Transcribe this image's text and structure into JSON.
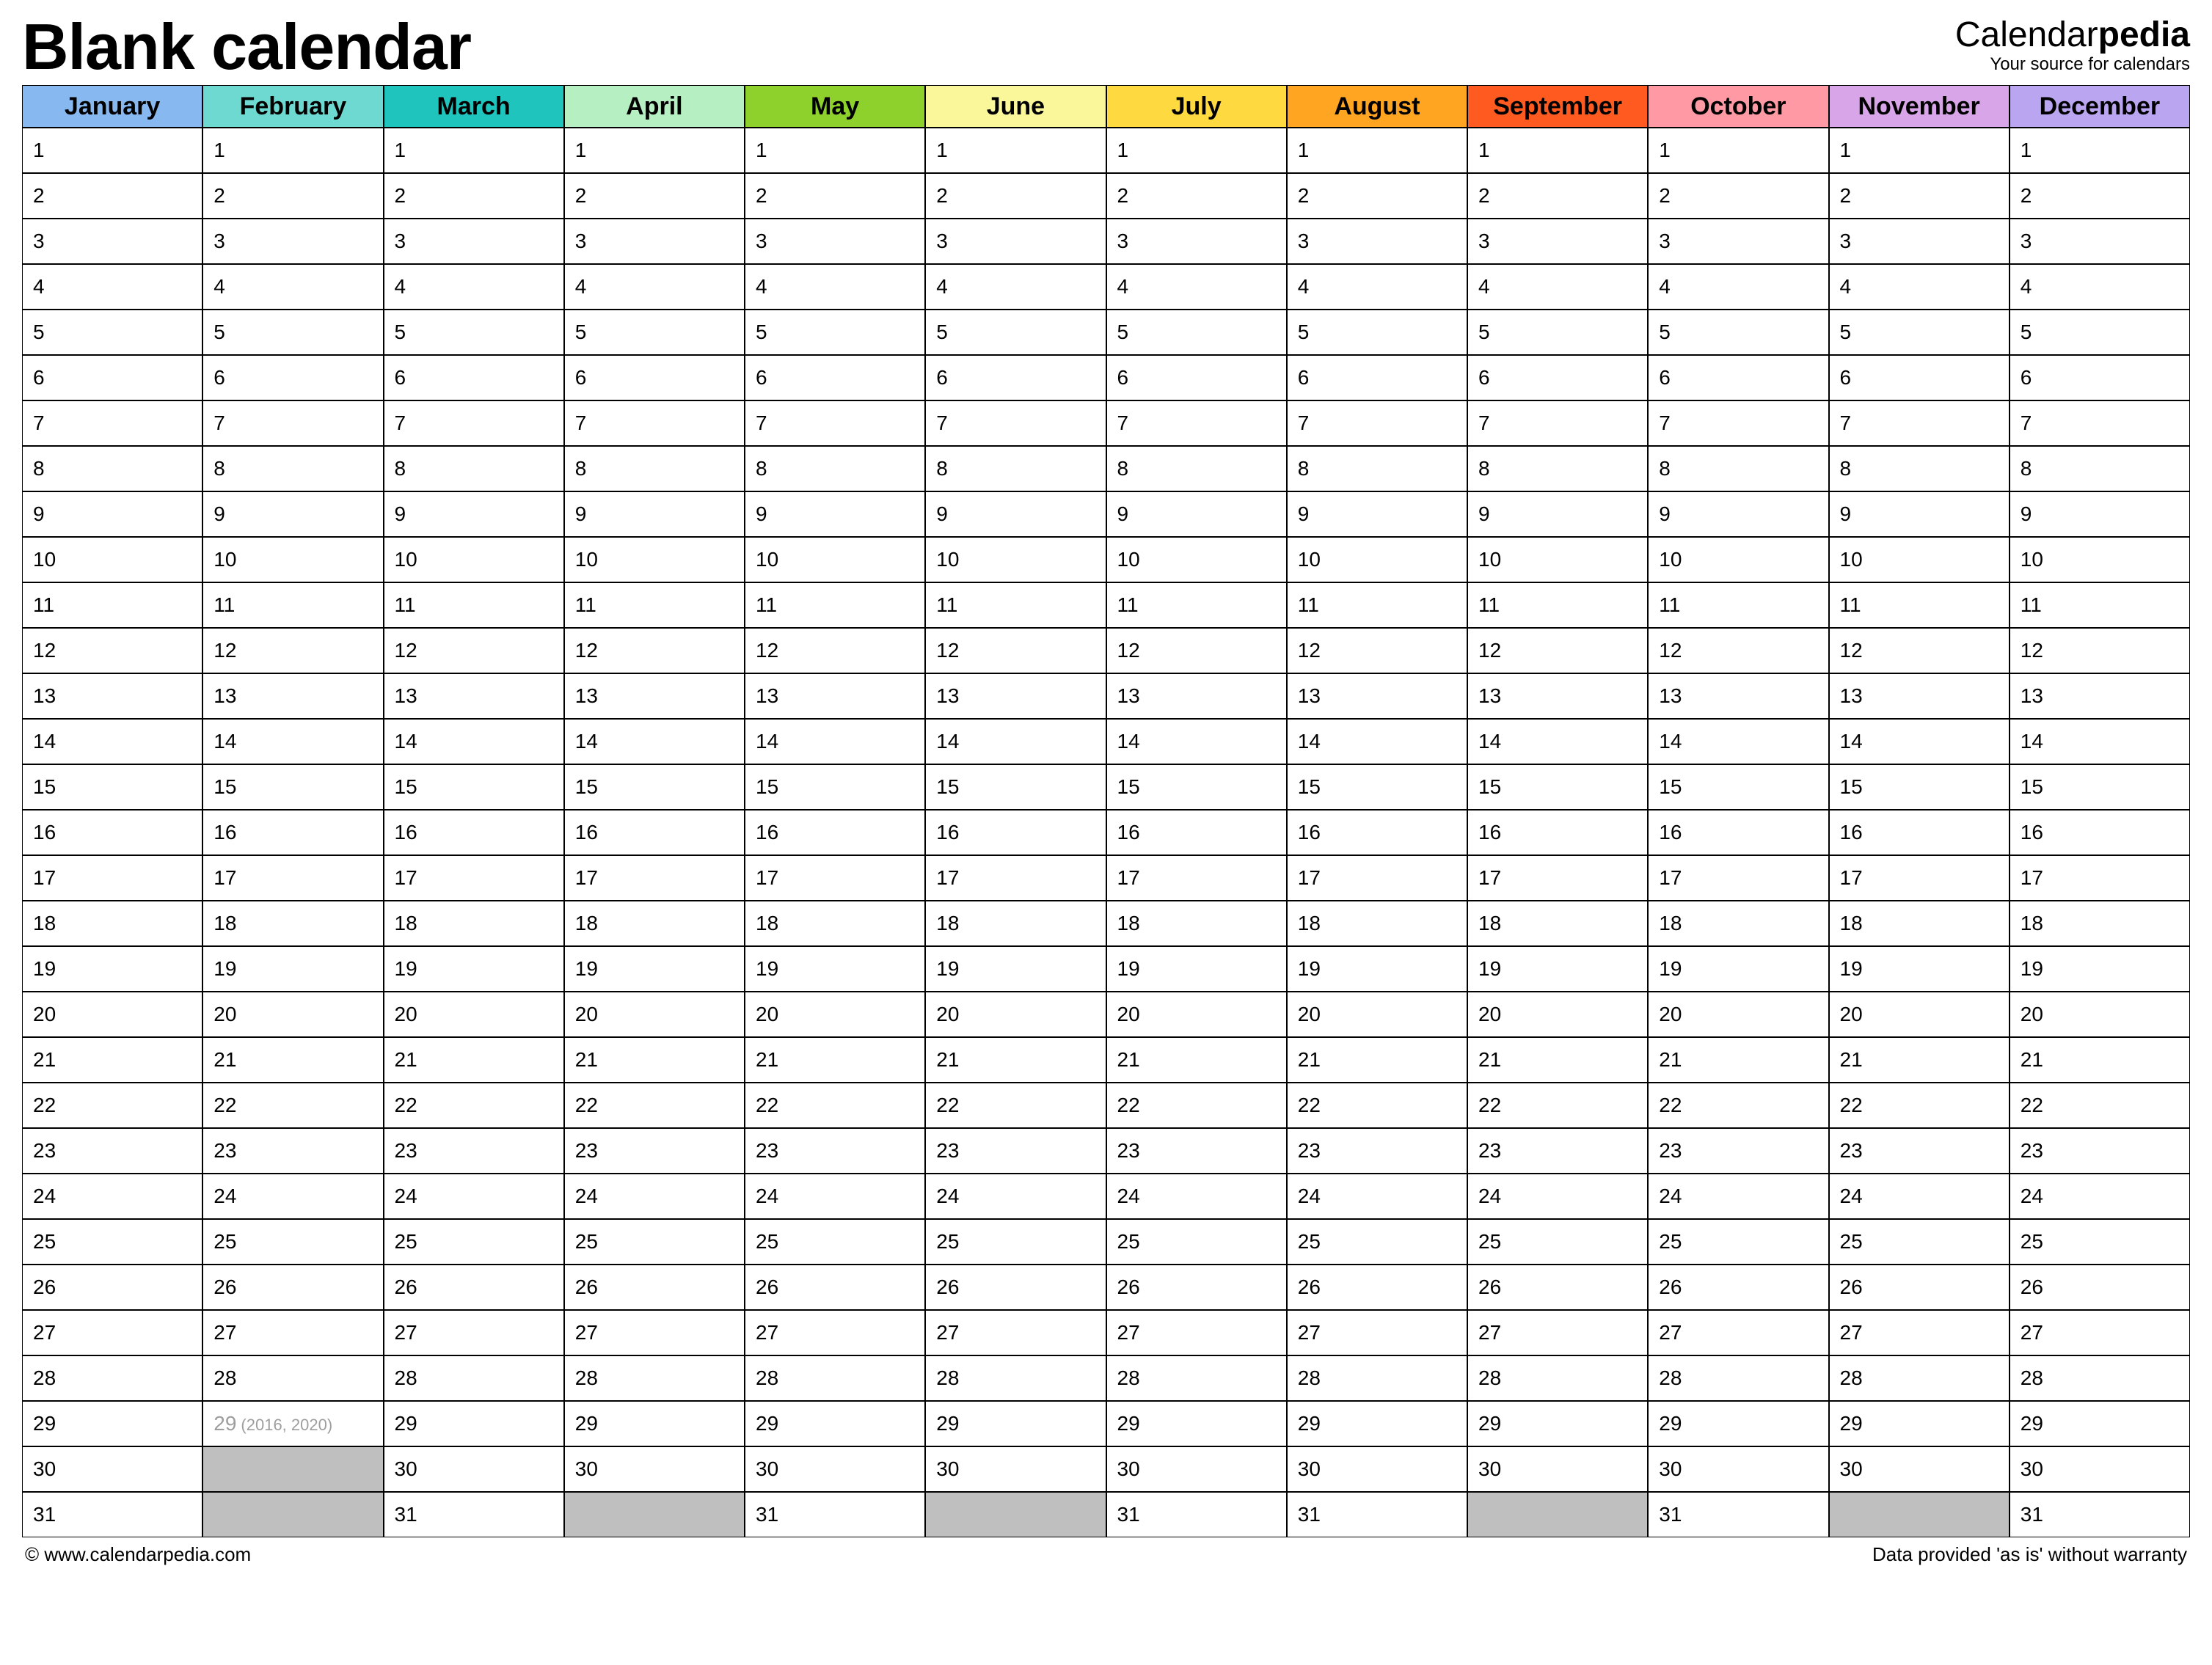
{
  "header": {
    "title": "Blank calendar",
    "brand_prefix": "Calendar",
    "brand_bold": "pedia",
    "tagline": "Your source for calendars"
  },
  "columns": [
    {
      "name": "January",
      "color": "#88b8f0",
      "days": 31
    },
    {
      "name": "February",
      "color": "#6ed9d1",
      "days": 29,
      "leap_day": 29,
      "leap_note": "(2016, 2020)"
    },
    {
      "name": "March",
      "color": "#1fc4bd",
      "days": 31
    },
    {
      "name": "April",
      "color": "#b6f0c2",
      "days": 30
    },
    {
      "name": "May",
      "color": "#8fd12c",
      "days": 31
    },
    {
      "name": "June",
      "color": "#f9f79a",
      "days": 30
    },
    {
      "name": "July",
      "color": "#ffd940",
      "days": 31
    },
    {
      "name": "August",
      "color": "#ffa521",
      "days": 31
    },
    {
      "name": "September",
      "color": "#ff5a1f",
      "days": 30
    },
    {
      "name": "October",
      "color": "#ff9aa5",
      "days": 31
    },
    {
      "name": "November",
      "color": "#d7a5e8",
      "days": 30
    },
    {
      "name": "December",
      "color": "#b9a5f0",
      "days": 31
    }
  ],
  "rows": 31,
  "footer": {
    "left": "© www.calendarpedia.com",
    "right": "Data provided 'as is' without warranty"
  }
}
